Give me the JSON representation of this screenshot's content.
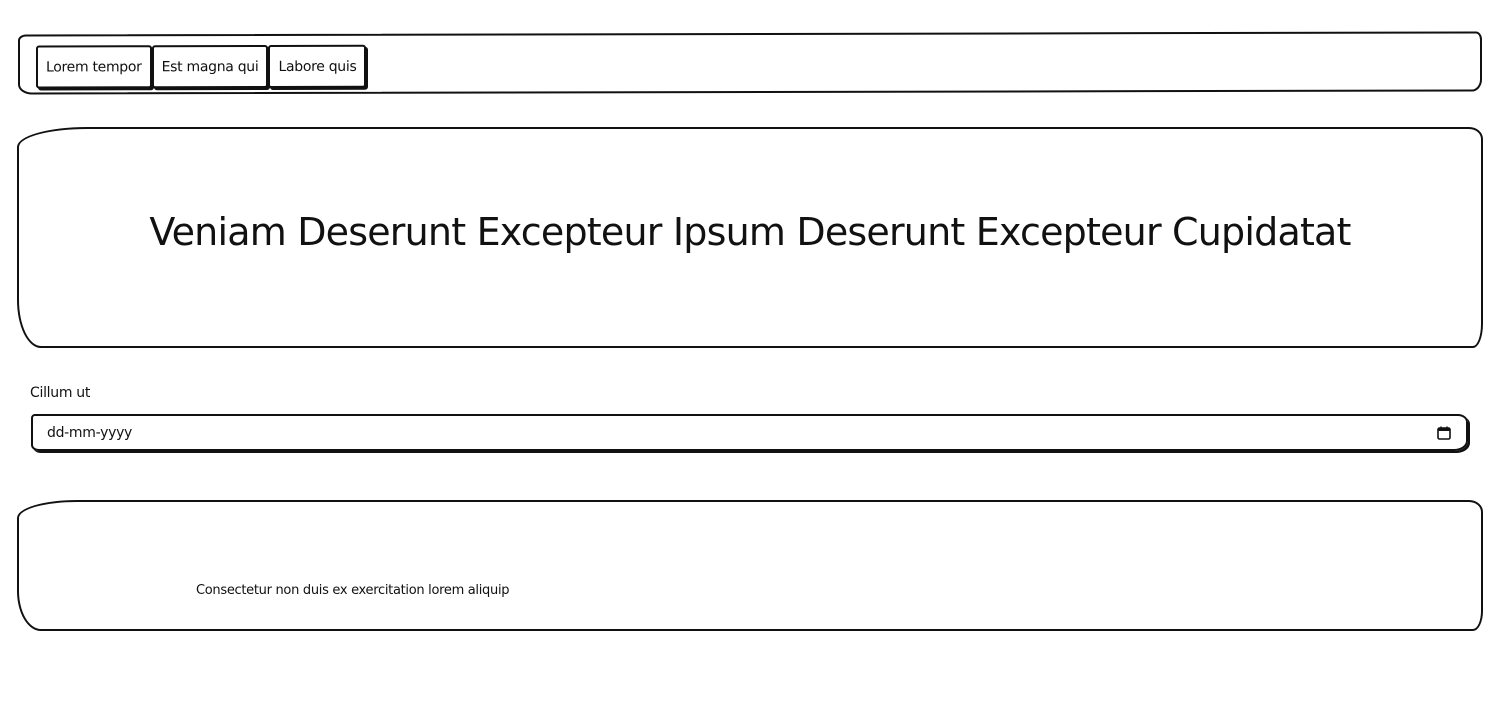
{
  "tabs": [
    {
      "label": "Lorem tempor"
    },
    {
      "label": "Est magna qui"
    },
    {
      "label": "Labore quis"
    }
  ],
  "hero": {
    "title": "Veniam Deserunt Excepteur Ipsum Deserunt Excepteur Cupidatat"
  },
  "date_field": {
    "label": "Cillum ut",
    "placeholder": "dd-mm-yyyy",
    "icon": "calendar-icon"
  },
  "card": {
    "text": "Consectetur non duis ex exercitation lorem aliquip"
  }
}
